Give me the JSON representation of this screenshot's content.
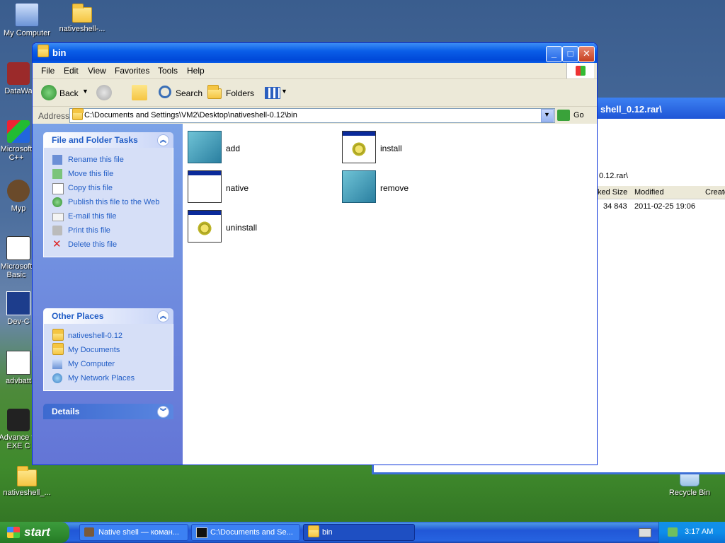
{
  "desktop": {
    "icons": [
      {
        "label": "My Computer"
      },
      {
        "label": "nativeshell-..."
      },
      {
        "label": "DataWa"
      },
      {
        "label": "Microsoft C++"
      },
      {
        "label": "Myp"
      },
      {
        "label": "Microsoft Basic"
      },
      {
        "label": "Dev-C"
      },
      {
        "label": "advbatt"
      },
      {
        "label": "Advance to EXE C"
      },
      {
        "label": "nativeshell_..."
      },
      {
        "label": "Recycle Bin"
      }
    ]
  },
  "background_window": {
    "title": "shell_0.12.rar\\",
    "path": "0.12.rar\\",
    "columns": [
      "ked Size",
      "Modified",
      "Create"
    ],
    "row": {
      "size": "34 843",
      "modified": "2011-02-25 19:06"
    }
  },
  "window": {
    "title": "bin",
    "menu": [
      "File",
      "Edit",
      "View",
      "Favorites",
      "Tools",
      "Help"
    ],
    "toolbar": {
      "back": "Back",
      "search": "Search",
      "folders": "Folders"
    },
    "address": {
      "label": "Address",
      "value": "C:\\Documents and Settings\\VM2\\Desktop\\nativeshell-0.12\\bin",
      "go": "Go"
    },
    "tasks": {
      "title": "File and Folder Tasks",
      "items": [
        "Rename this file",
        "Move this file",
        "Copy this file",
        "Publish this file to the Web",
        "E-mail this file",
        "Print this file",
        "Delete this file"
      ]
    },
    "places": {
      "title": "Other Places",
      "items": [
        "nativeshell-0.12",
        "My Documents",
        "My Computer",
        "My Network Places"
      ]
    },
    "details": {
      "title": "Details"
    },
    "files": [
      {
        "name": "add",
        "icon": "registry-icon"
      },
      {
        "name": "install",
        "icon": "application-gear-icon"
      },
      {
        "name": "native",
        "icon": "application-icon"
      },
      {
        "name": "remove",
        "icon": "registry-icon"
      },
      {
        "name": "uninstall",
        "icon": "application-gear-icon"
      }
    ]
  },
  "taskbar": {
    "start": "start",
    "buttons": [
      "Native shell — коман...",
      "C:\\Documents and Se...",
      "bin"
    ],
    "clock": "3:17 AM"
  }
}
